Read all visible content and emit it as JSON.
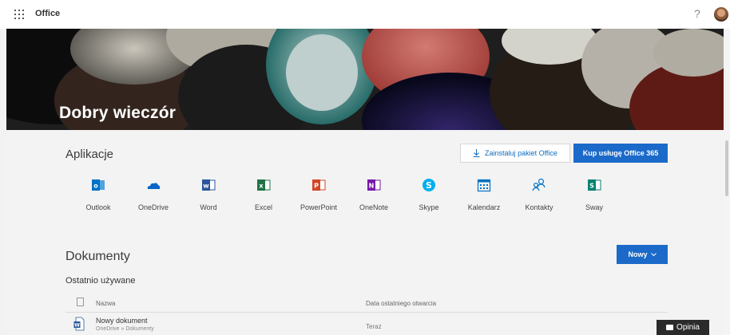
{
  "topbar": {
    "brand": "Office",
    "help": "?"
  },
  "hero": {
    "greeting": "Dobry wieczór"
  },
  "apps_section": {
    "title": "Aplikacje",
    "install_label": "Zainstaluj pakiet Office",
    "buy_label": "Kup usługę Office 365",
    "apps": [
      {
        "label": "Outlook",
        "icon": "outlook-icon",
        "color": "#0072c6"
      },
      {
        "label": "OneDrive",
        "icon": "onedrive-icon",
        "color": "#0a64c8"
      },
      {
        "label": "Word",
        "icon": "word-icon",
        "color": "#2b579a"
      },
      {
        "label": "Excel",
        "icon": "excel-icon",
        "color": "#217346"
      },
      {
        "label": "PowerPoint",
        "icon": "powerpoint-icon",
        "color": "#d24726"
      },
      {
        "label": "OneNote",
        "icon": "onenote-icon",
        "color": "#7719aa"
      },
      {
        "label": "Skype",
        "icon": "skype-icon",
        "color": "#00aff0"
      },
      {
        "label": "Kalendarz",
        "icon": "calendar-icon",
        "color": "#0072c6"
      },
      {
        "label": "Kontakty",
        "icon": "people-icon",
        "color": "#0072c6"
      },
      {
        "label": "Sway",
        "icon": "sway-icon",
        "color": "#008272"
      }
    ]
  },
  "docs_section": {
    "title": "Dokumenty",
    "new_label": "Nowy",
    "recent_label": "Ostatnio używane",
    "columns": {
      "name": "Nazwa",
      "date": "Data ostatniego otwarcia"
    },
    "rows": [
      {
        "name": "Nowy dokument",
        "path": "OneDrive » Dokumenty",
        "date": "Teraz"
      }
    ]
  },
  "feedback_label": "Opinia",
  "colors": {
    "accent": "#1b6ac9",
    "link": "#0f6cbd"
  }
}
